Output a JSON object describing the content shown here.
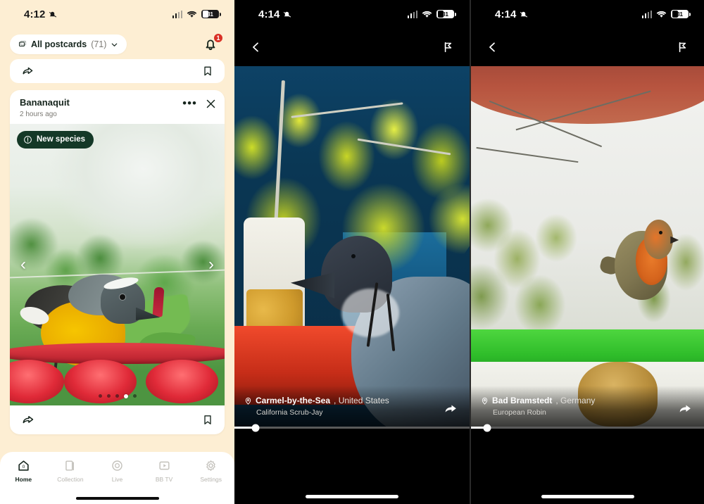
{
  "panel1": {
    "statusbar": {
      "time": "4:12",
      "mute_icon": "bell-slash-icon",
      "battery": "31"
    },
    "filter_chip": {
      "icon": "postcards-icon",
      "label": "All postcards",
      "count": "(71)",
      "chevron": "chevron-down-icon"
    },
    "notifications": {
      "icon": "bell-icon",
      "badge": "1"
    },
    "top_strip": {
      "share_icon": "share-icon",
      "bookmark_icon": "bookmark-icon"
    },
    "card": {
      "title": "Bananaquit",
      "timestamp": "2 hours ago",
      "more_label": "•••",
      "close_label": "✕",
      "badge": {
        "icon": "info-icon",
        "label": "New species"
      },
      "prev_label": "‹",
      "next_label": "›",
      "pager": {
        "total": 5,
        "active_index": 3
      },
      "share_icon": "share-icon",
      "bookmark_icon": "bookmark-icon"
    },
    "tabbar": {
      "items": [
        {
          "icon": "home-icon",
          "label": "Home",
          "active": true
        },
        {
          "icon": "collection-icon",
          "label": "Collection",
          "active": false
        },
        {
          "icon": "live-icon",
          "label": "Live",
          "active": false
        },
        {
          "icon": "tv-icon",
          "label": "BB TV",
          "active": false
        },
        {
          "icon": "gear-icon",
          "label": "Settings",
          "active": false
        }
      ]
    }
  },
  "panel2": {
    "statusbar": {
      "time": "4:14",
      "mute_icon": "bell-slash-icon",
      "battery": "31"
    },
    "nav": {
      "back_icon": "chevron-left-icon",
      "flag_icon": "flag-icon"
    },
    "caption": {
      "pin_icon": "location-pin-icon",
      "place": "Carmel-by-the-Sea",
      "country": ", United States",
      "species": "California Scrub-Jay",
      "share_icon": "share-icon"
    },
    "scrubber": {
      "progress": "9%"
    }
  },
  "panel3": {
    "statusbar": {
      "time": "4:14",
      "mute_icon": "bell-slash-icon",
      "battery": "31"
    },
    "nav": {
      "back_icon": "chevron-left-icon",
      "flag_icon": "flag-icon"
    },
    "caption": {
      "pin_icon": "location-pin-icon",
      "place": "Bad Bramstedt",
      "country": ", Germany",
      "species": "European Robin",
      "share_icon": "share-icon"
    },
    "scrubber": {
      "progress": "7%"
    }
  },
  "colors": {
    "cream": "#fdeed3",
    "dark_green": "#143827",
    "badge_red": "#d93025",
    "text_dark": "#15241c",
    "muted": "#7c7a74"
  }
}
